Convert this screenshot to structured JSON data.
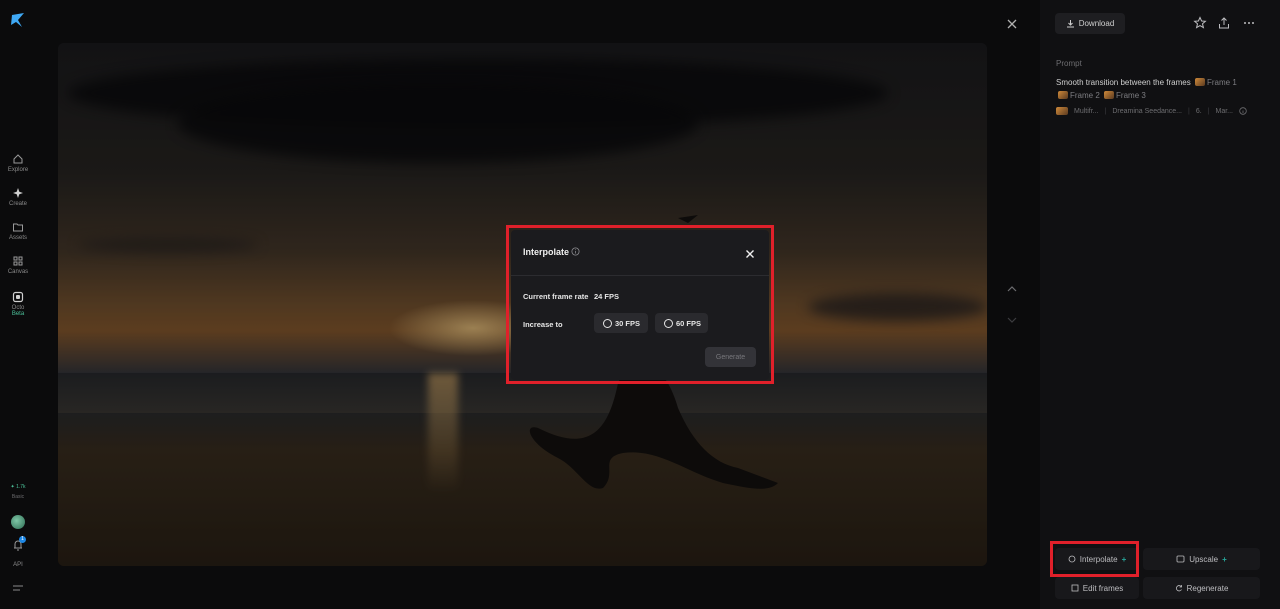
{
  "sidebar": {
    "items": [
      {
        "label": "Explore",
        "icon": "home-icon"
      },
      {
        "label": "Create",
        "icon": "sparkle-icon"
      },
      {
        "label": "Assets",
        "icon": "folder-icon"
      },
      {
        "label": "Canvas",
        "icon": "canvas-icon"
      },
      {
        "label": "Octo",
        "icon": "octo-icon",
        "badge": "Beta"
      }
    ],
    "credits": "✦ 1.7k",
    "credits_sub": "Basic",
    "api_label": "API",
    "notification_count": "1"
  },
  "toolbar": {
    "download_label": "Download"
  },
  "prompt": {
    "label": "Prompt",
    "text": "Smooth transition between the frames",
    "frames": [
      "Frame 1",
      "Frame 2",
      "Frame 3"
    ],
    "meta": [
      "Multifr...",
      "Dreamina Seedance...",
      "6.",
      "Mar..."
    ]
  },
  "actions": {
    "interpolate": "Interpolate",
    "upscale": "Upscale",
    "edit_frames": "Edit frames",
    "regenerate": "Regenerate"
  },
  "modal": {
    "title": "Interpolate",
    "current_frame_rate_label": "Current frame rate",
    "current_frame_rate_value": "24 FPS",
    "increase_to_label": "Increase to",
    "options": [
      "30 FPS",
      "60 FPS"
    ],
    "generate_label": "Generate"
  },
  "colors": {
    "accent": "#26a69a",
    "highlight": "#e0202a",
    "background": "#0b0b0c"
  }
}
